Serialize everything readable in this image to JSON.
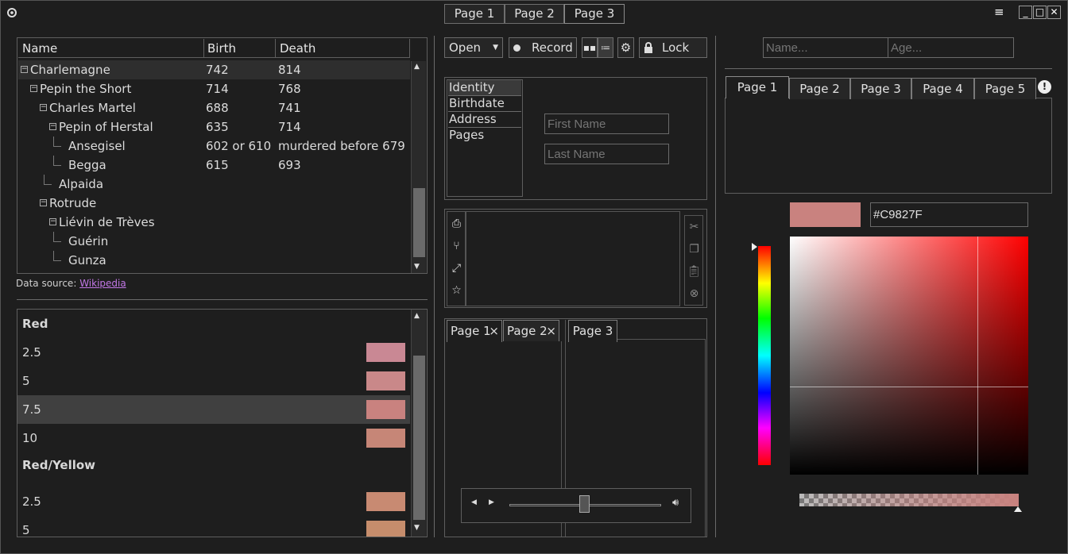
{
  "window": {
    "tabs": [
      "Page 1",
      "Page 2",
      "Page 3"
    ],
    "active_tab": 2
  },
  "tree": {
    "columns": [
      "Name",
      "Birth",
      "Death"
    ],
    "rows": [
      {
        "name": "Charlemagne",
        "birth": "742",
        "death": "814",
        "level": 0,
        "expander": true
      },
      {
        "name": "Pepin the Short",
        "birth": "714",
        "death": "768",
        "level": 1,
        "expander": true
      },
      {
        "name": "Charles Martel",
        "birth": "688",
        "death": "741",
        "level": 2,
        "expander": true
      },
      {
        "name": "Pepin of Herstal",
        "birth": "635",
        "death": "714",
        "level": 3,
        "expander": true
      },
      {
        "name": "Ansegisel",
        "birth": "602 or 610",
        "death": "murdered before 679",
        "level": 4,
        "expander": false
      },
      {
        "name": "Begga",
        "birth": "615",
        "death": "693",
        "level": 4,
        "expander": false
      },
      {
        "name": "Alpaida",
        "birth": "",
        "death": "",
        "level": 3,
        "expander": false
      },
      {
        "name": "Rotrude",
        "birth": "",
        "death": "",
        "level": 2,
        "expander": true
      },
      {
        "name": "Liévin de Trèves",
        "birth": "",
        "death": "",
        "level": 3,
        "expander": true
      },
      {
        "name": "Guérin",
        "birth": "",
        "death": "",
        "level": 4,
        "expander": false
      },
      {
        "name": "Gunza",
        "birth": "",
        "death": "",
        "level": 4,
        "expander": false
      }
    ],
    "source_label": "Data source:",
    "source_link": "Wikipedia"
  },
  "swatches": {
    "items": [
      {
        "type": "header",
        "label": "Red"
      },
      {
        "type": "item",
        "label": "2.5",
        "color": "#c98894"
      },
      {
        "type": "item",
        "label": "5",
        "color": "#c98889"
      },
      {
        "type": "item",
        "label": "7.5",
        "color": "#c9827f",
        "selected": true
      },
      {
        "type": "item",
        "label": "10",
        "color": "#c68677"
      },
      {
        "type": "header",
        "label": "Red/Yellow"
      },
      {
        "type": "item",
        "label": "2.5",
        "color": "#c88a72"
      },
      {
        "type": "item",
        "label": "5",
        "color": "#c68d6c"
      }
    ]
  },
  "toolbar": {
    "open_label": "Open",
    "record_label": "Record",
    "lock_label": "Lock"
  },
  "form": {
    "list": [
      "Identity",
      "Birthdate",
      "Address",
      "Pages"
    ],
    "first_name_placeholder": "First Name",
    "last_name_placeholder": "Last Name"
  },
  "inner_tabs": {
    "left": [
      "Page 1",
      "Page 2"
    ],
    "right": [
      "Page 3"
    ]
  },
  "right_panel": {
    "name_placeholder": "Name...",
    "age_placeholder": "Age...",
    "tabs": [
      "Page 1",
      "Page 2",
      "Page 3",
      "Page 4",
      "Page 5"
    ],
    "alert_icon": "!"
  },
  "color": {
    "hex": "#C9827F",
    "value": "#c9827f"
  },
  "media": {
    "position": 0.49
  }
}
